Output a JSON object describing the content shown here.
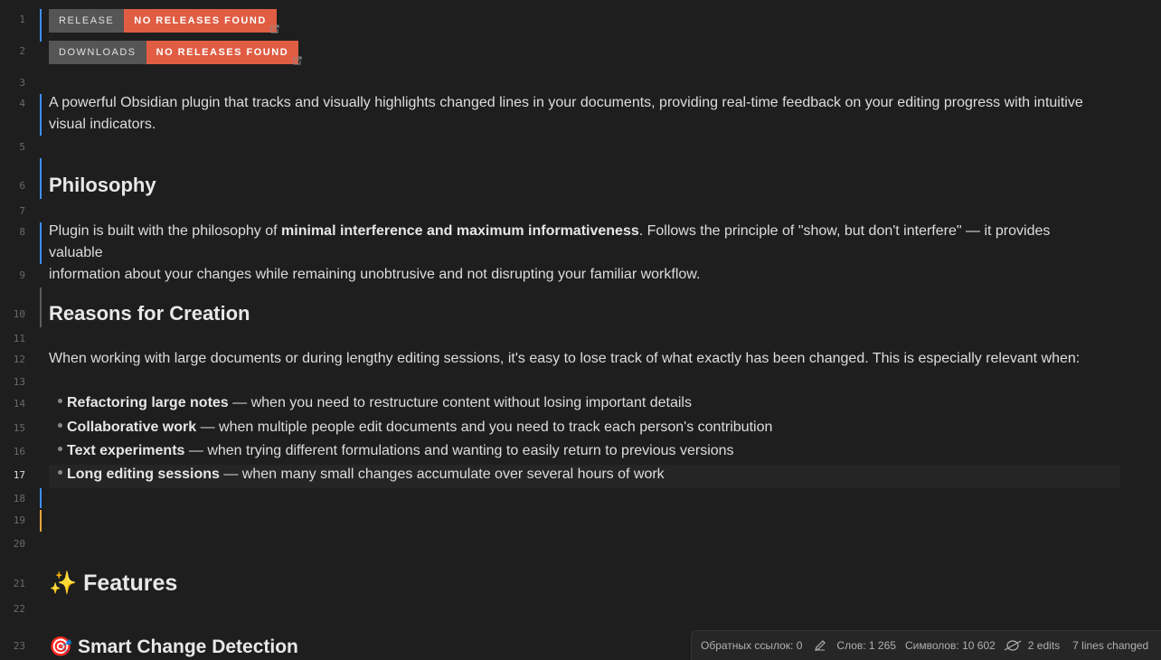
{
  "line_numbers": [
    "1",
    "2",
    "3",
    "4",
    "5",
    "6",
    "7",
    "8",
    "9",
    "10",
    "11",
    "12",
    "13",
    "14",
    "15",
    "16",
    "17",
    "18",
    "19",
    "20",
    "21",
    "22",
    "23"
  ],
  "badges": {
    "release": {
      "label": "RELEASE",
      "value": "NO RELEASES FOUND"
    },
    "downloads": {
      "label": "DOWNLOADS",
      "value": "NO RELEASES FOUND"
    }
  },
  "intro": {
    "line1": "A powerful Obsidian plugin that tracks and visually highlights changed lines in your documents, providing real-time feedback on your editing progress with intuitive",
    "line2": "visual indicators."
  },
  "philosophy": {
    "heading": "Philosophy",
    "pre": "Plugin is built with the philosophy of ",
    "bold": "minimal interference and maximum informativeness",
    "post": ". Follows the principle of \"show, but don't interfere\" — it provides valuable",
    "line2": "information about your changes while remaining unobtrusive and not disrupting your familiar workflow."
  },
  "reasons": {
    "heading": "Reasons for Creation",
    "text": "When working with large documents or during lengthy editing sessions, it's easy to lose track of what exactly has been changed. This is especially relevant when:",
    "items": [
      {
        "bold": "Refactoring large notes",
        "text": " — when you need to restructure content without losing important details"
      },
      {
        "bold": "Collaborative work",
        "text": " — when multiple people edit documents and you need to track each person's contribution"
      },
      {
        "bold": "Text experiments",
        "text": " — when trying different formulations and wanting to easily return to previous versions"
      },
      {
        "bold": "Long editing sessions",
        "text": " — when many small changes accumulate over several hours of work"
      }
    ]
  },
  "features": {
    "emoji": "✨",
    "heading": "Features",
    "sub_emoji": "🎯",
    "sub_heading": "Smart Change Detection"
  },
  "status": {
    "backlinks": "Обратных ссылок: 0",
    "words": "Слов: 1 265",
    "chars": "Символов: 10 602",
    "edits": "2 edits",
    "lines_changed": "7 lines changed",
    "pencil_icon": "pencil-icon",
    "edits_icon": "no-edit-icon"
  },
  "colors": {
    "accent_blue": "#3d8eff",
    "badge_red": "#e05d44",
    "changed_orange": "#e8a33d"
  }
}
